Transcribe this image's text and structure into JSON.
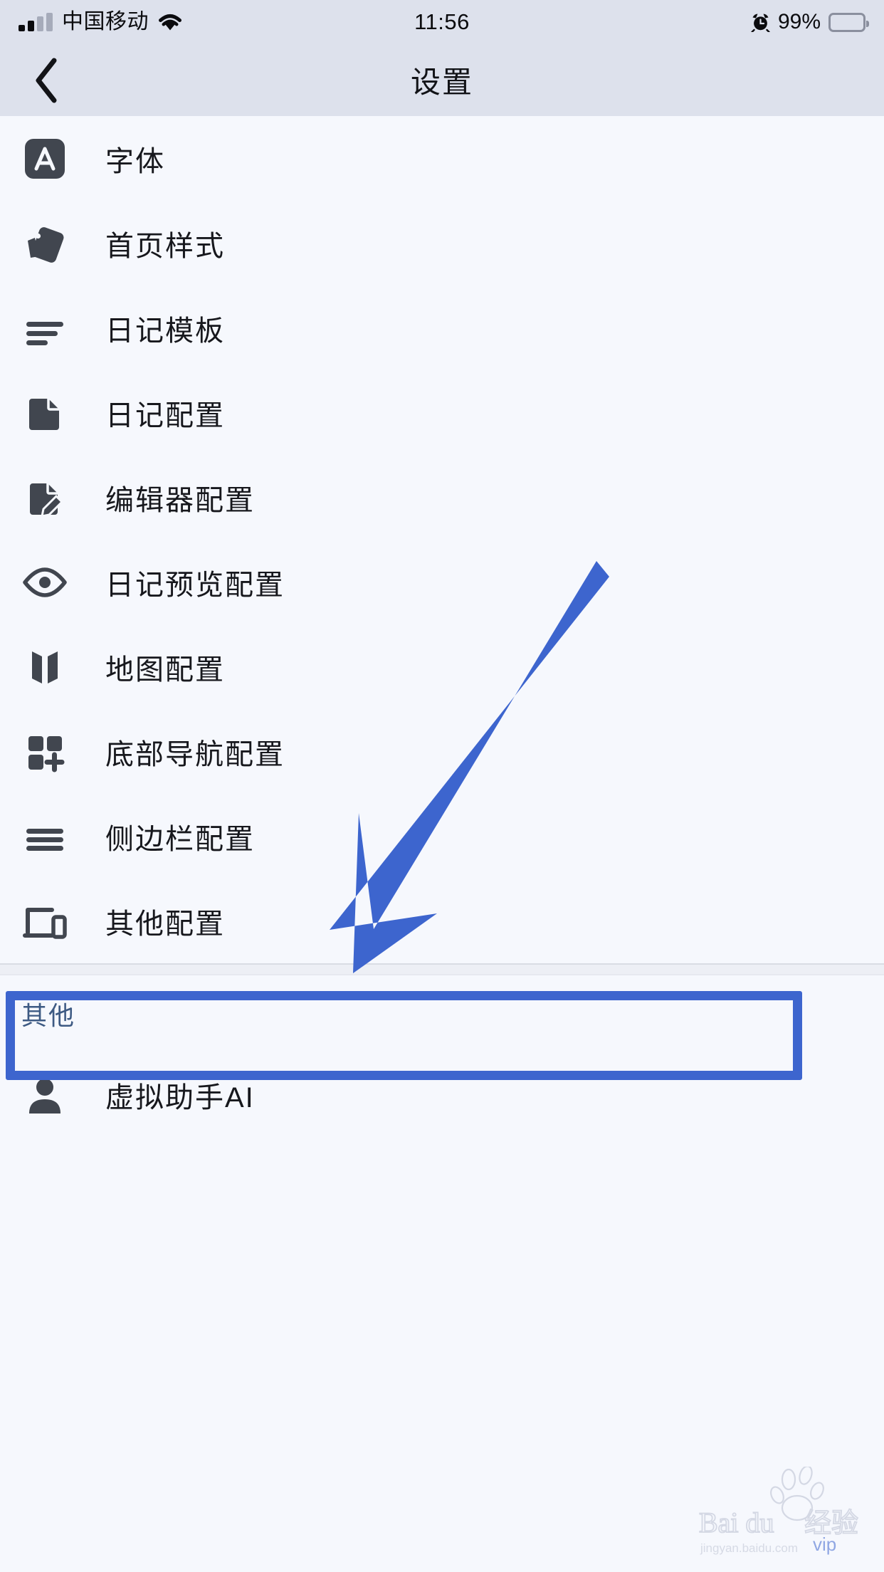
{
  "status_bar": {
    "carrier": "中国移动",
    "time": "11:56",
    "battery_percent": "99%",
    "signal_icon": "signal-bars-icon",
    "wifi_icon": "wifi-icon",
    "alarm_icon": "alarm-clock-icon",
    "battery_icon": "battery-icon"
  },
  "navbar": {
    "title": "设置",
    "back_icon": "chevron-left-icon"
  },
  "settings": {
    "items": [
      {
        "label": "字体",
        "icon": "font-a-icon"
      },
      {
        "label": "首页样式",
        "icon": "card-stack-icon"
      },
      {
        "label": "日记模板",
        "icon": "list-lines-icon"
      },
      {
        "label": "日记配置",
        "icon": "document-icon"
      },
      {
        "label": "编辑器配置",
        "icon": "document-pencil-icon"
      },
      {
        "label": "日记预览配置",
        "icon": "eye-icon"
      },
      {
        "label": "地图配置",
        "icon": "map-icon"
      },
      {
        "label": "底部导航配置",
        "icon": "grid-plus-icon"
      },
      {
        "label": "侧边栏配置",
        "icon": "hamburger-icon"
      },
      {
        "label": "其他配置",
        "icon": "laptop-phone-icon"
      }
    ]
  },
  "other_section": {
    "header": "其他",
    "items": [
      {
        "label": "虚拟助手AI",
        "icon": "person-icon"
      }
    ]
  },
  "annotation": {
    "highlight_color": "#3d65ce",
    "highlighted_item": "底部导航配置",
    "arrow_icon": "arrow-pointing-down-left-icon"
  },
  "watermark": {
    "brand": "Bai du",
    "product": "经验",
    "url": "jingyan.baidu.com",
    "badge": "vip"
  }
}
